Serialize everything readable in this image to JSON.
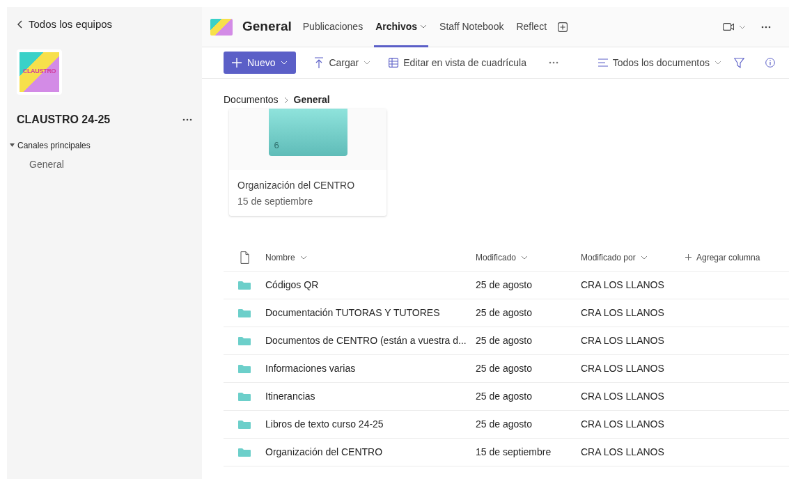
{
  "sidebar": {
    "back_label": "Todos los equipos",
    "team_logo_text": "CLAUSTRO",
    "team_name": "CLAUSTRO 24-25",
    "sections": [
      {
        "label": "Canales principales",
        "expanded": true,
        "children": [
          {
            "label": "General"
          }
        ]
      }
    ]
  },
  "header": {
    "channel": "General",
    "tabs": [
      {
        "label": "Publicaciones",
        "selected": false,
        "dropdown": false
      },
      {
        "label": "Archivos",
        "selected": true,
        "dropdown": true
      },
      {
        "label": "Staff Notebook",
        "selected": false,
        "dropdown": false
      },
      {
        "label": "Reflect",
        "selected": false,
        "dropdown": false
      }
    ]
  },
  "toolbar": {
    "new_label": "Nuevo",
    "upload_label": "Cargar",
    "grid_label": "Editar en vista de cuadrícula",
    "view_label": "Todos los documentos"
  },
  "breadcrumb": [
    {
      "label": "Documentos",
      "current": false
    },
    {
      "label": "General",
      "current": true
    }
  ],
  "tiles": [
    {
      "name": "Organización del CENTRO",
      "date": "15 de septiembre",
      "count": "6"
    }
  ],
  "table": {
    "columns": [
      "Nombre",
      "Modificado",
      "Modificado por"
    ],
    "add_column": "Agregar columna",
    "rows": [
      {
        "name": "Códigos QR",
        "modified": "25 de agosto",
        "modified_by": "CRA LOS LLANOS"
      },
      {
        "name": "Documentación TUTORAS Y TUTORES",
        "modified": "25 de agosto",
        "modified_by": "CRA LOS LLANOS"
      },
      {
        "name": "Documentos de CENTRO (están a vuestra d...",
        "modified": "25 de agosto",
        "modified_by": "CRA LOS LLANOS"
      },
      {
        "name": "Informaciones varias",
        "modified": "25 de agosto",
        "modified_by": "CRA LOS LLANOS"
      },
      {
        "name": "Itinerancias",
        "modified": "25 de agosto",
        "modified_by": "CRA LOS LLANOS"
      },
      {
        "name": "Libros de texto curso 24-25",
        "modified": "25 de agosto",
        "modified_by": "CRA LOS LLANOS"
      },
      {
        "name": "Organización del CENTRO",
        "modified": "15 de septiembre",
        "modified_by": "CRA LOS LLANOS"
      }
    ]
  }
}
